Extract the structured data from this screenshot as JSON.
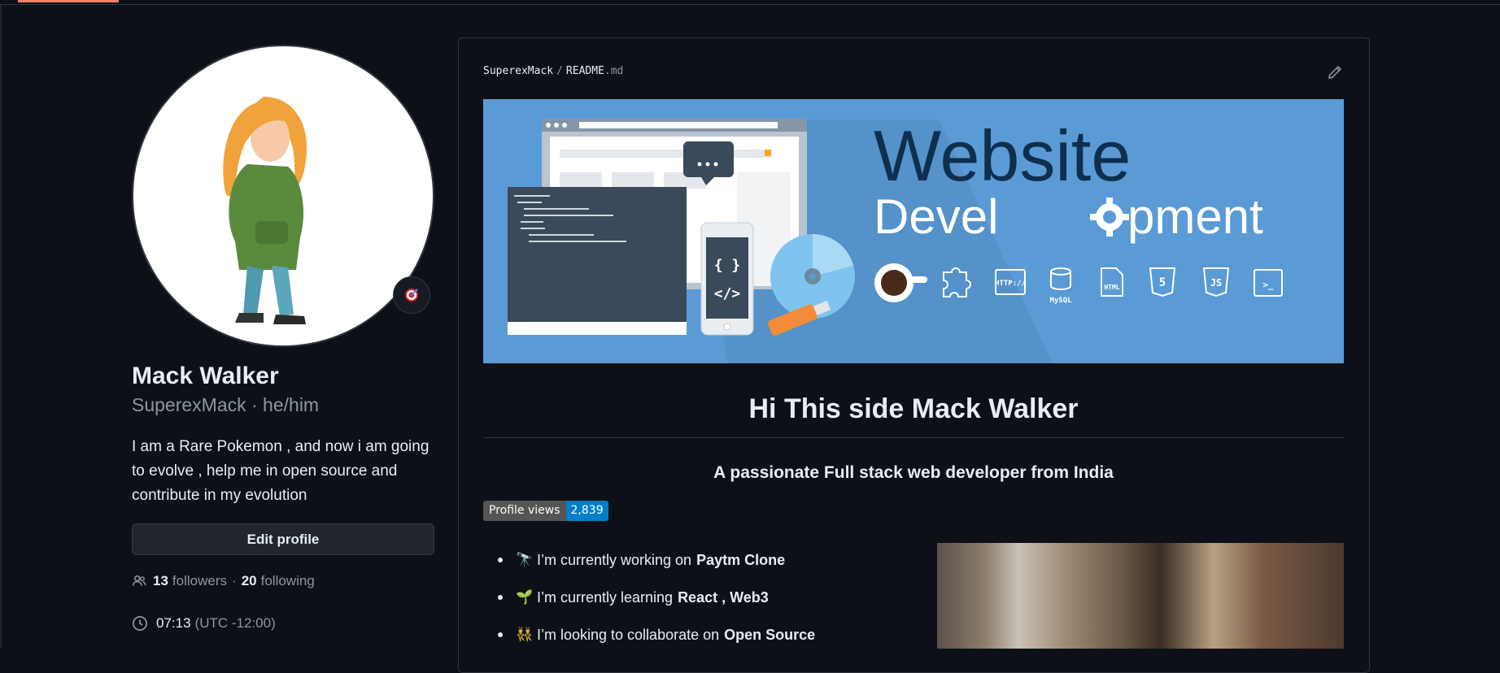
{
  "profile": {
    "name": "Mack Walker",
    "login_line": "SuperexMack · he/him",
    "bio": "I am a Rare Pokemon , and now i am going to evolve , help me in open source and contribute in my evolution",
    "edit_label": "Edit profile",
    "followers_count": "13",
    "followers_label": "followers",
    "separator": "·",
    "following_count": "20",
    "following_label": "following",
    "local_time": "07:13",
    "timezone": "(UTC -12:00)"
  },
  "readme": {
    "owner": "SuperexMack",
    "separator": "/",
    "file": "README",
    "ext": ".md",
    "banner": {
      "title": "Website",
      "subtitle_a": "Devel",
      "subtitle_b": "pment",
      "icon_labels": [
        "HTTP://",
        "MySQL",
        "HTML",
        "5",
        "JS",
        ">_"
      ],
      "code_symbols": [
        "{ }",
        "</>"
      ]
    },
    "heading": "Hi This side Mack Walker",
    "subheading": "A passionate Full stack web developer from India",
    "badge": {
      "label": "Profile views",
      "value": "2,839"
    },
    "items": [
      {
        "emoji": "🔭",
        "text": "I’m currently working on",
        "bold": "Paytm Clone"
      },
      {
        "emoji": "🌱",
        "text": "I’m currently learning",
        "bold": "React , Web3"
      },
      {
        "emoji": "👯",
        "text": "I’m looking to collaborate on",
        "bold": "Open Source"
      }
    ]
  },
  "colors": {
    "background": "#0d1117",
    "text": "#e6edf3",
    "muted": "#8d96a0",
    "border": "#30363d",
    "tab_accent": "#f78166",
    "banner_blue": "#5b9bd5",
    "banner_title": "#0f2f4f",
    "badge_blue": "#007ec6"
  }
}
